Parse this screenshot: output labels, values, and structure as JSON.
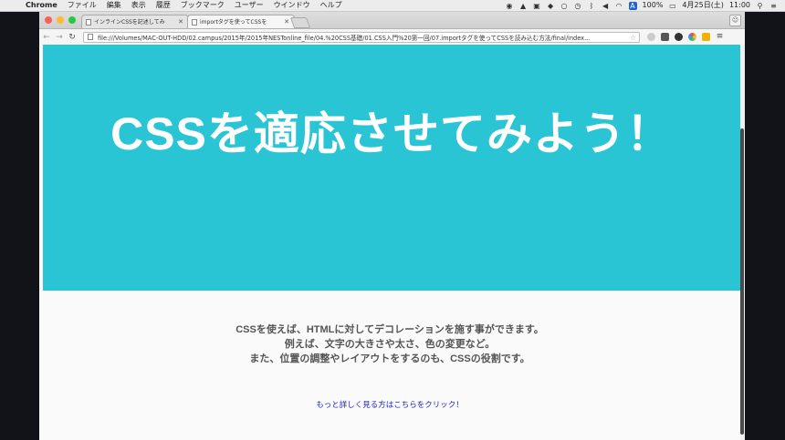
{
  "menubar": {
    "app_name": "Chrome",
    "items": [
      "ファイル",
      "編集",
      "表示",
      "履歴",
      "ブックマーク",
      "ユーザー",
      "ウインドウ",
      "ヘルプ"
    ],
    "battery": "100%",
    "date": "4月25日(土)",
    "time": "11:00",
    "user_initial": "A"
  },
  "browser": {
    "tabs": [
      {
        "title": "インラインCSSを記述してみ"
      },
      {
        "title": "importタグを使ってCSSを"
      }
    ],
    "url": "file:///Volumes/MAC-OUT-HDD/02.campus/2015年/2015年NESTonline_file/04.%20CSS基礎/01.CSS入門%20第一回/07.importタグを使ってCSSを読み込む方法/final/index..."
  },
  "page": {
    "hero_title": "CSSを適応させてみよう！",
    "hero_color": "#29c5d5",
    "paragraph_lines": [
      "CSSを使えば、HTMLに対してデコレーションを施す事ができます。",
      "例えば、文字の大きさや太さ、色の変更など。",
      "また、位置の調整やレイアウトをするのも、CSSの役割です。"
    ],
    "link_text": "もっと詳しく見る方はこちらをクリック！",
    "link_color": "#1a1fd0"
  }
}
